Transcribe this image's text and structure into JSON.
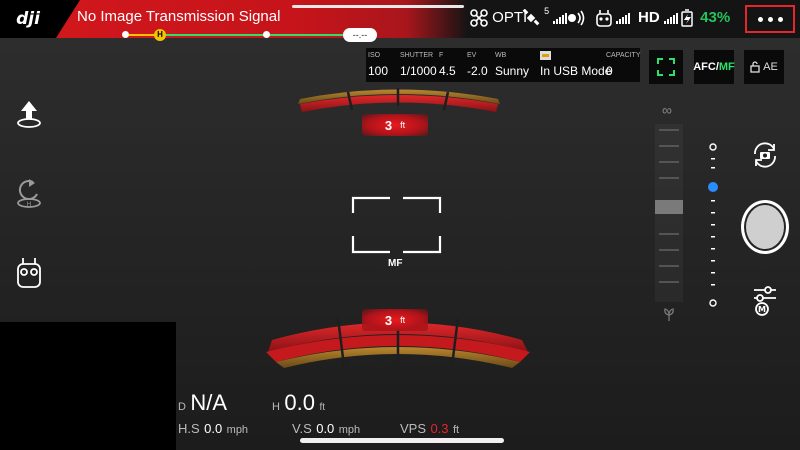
{
  "app": {
    "logo_text": "dji"
  },
  "topbar": {
    "signal_message": "No Image Transmission Signal",
    "flight_mode": "OPTI",
    "satellite_count": "5",
    "hd_label": "HD",
    "battery_percent": "43%",
    "altitude_pill": "--.--",
    "home_marker": "H"
  },
  "camera_params": [
    {
      "label": "ISO",
      "value": "100"
    },
    {
      "label": "SHUTTER",
      "value": "1/1000"
    },
    {
      "label": "F",
      "value": "4.5"
    },
    {
      "label": "EV",
      "value": "-2.0"
    },
    {
      "label": "WB",
      "value": "Sunny"
    },
    {
      "label": "",
      "value": "In USB Mode"
    },
    {
      "label": "CAPACITY",
      "value": "0"
    }
  ],
  "focus": {
    "afc_label": "AFC/",
    "mf_label": "MF",
    "ae_label": "AE",
    "frame_mode": "MF"
  },
  "obstacle": {
    "front_distance": "3",
    "rear_distance": "3",
    "unit": "ft"
  },
  "telemetry": {
    "distance_prefix": "D",
    "distance_value": "N/A",
    "height_prefix": "H",
    "height_value": "0.0",
    "height_unit": "ft",
    "hs_prefix": "H.S",
    "hs_value": "0.0",
    "hs_unit": "mph",
    "vs_prefix": "V.S",
    "vs_value": "0.0",
    "vs_unit": "mph",
    "vps_prefix": "VPS",
    "vps_value": "0.3",
    "vps_unit": "ft"
  },
  "gimbal": {
    "infinity_symbol": "∞"
  },
  "colors": {
    "alert_red": "#d0171c",
    "battery_green": "#25c25a",
    "accent_green": "#2ee06a",
    "slider_blue": "#2a8cff",
    "home_yellow": "#f5c400"
  }
}
